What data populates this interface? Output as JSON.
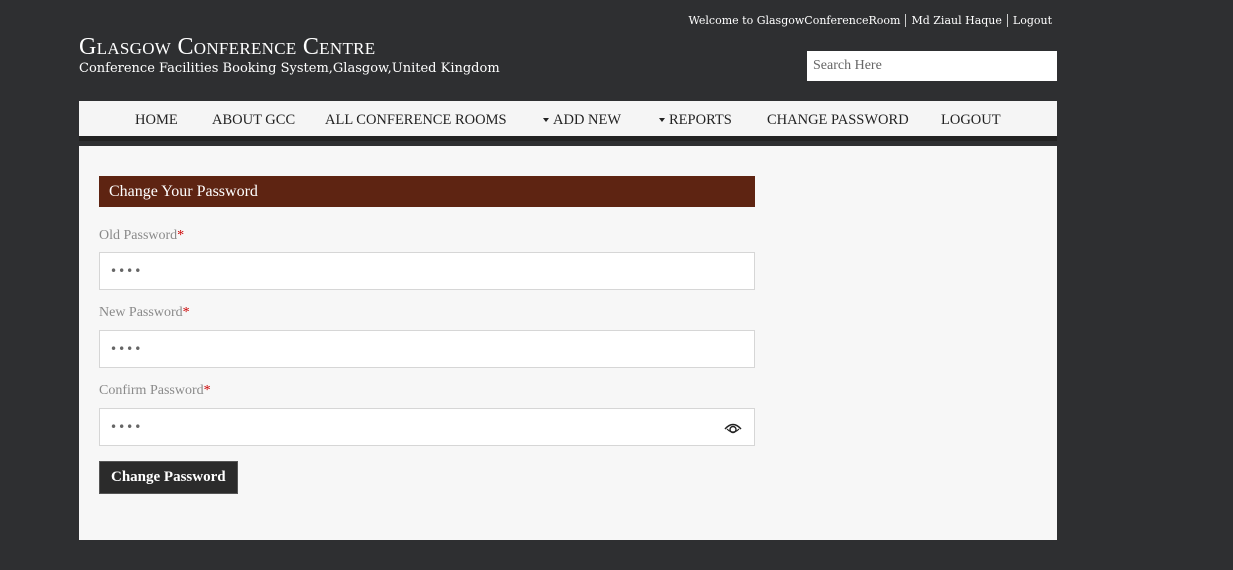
{
  "topbar": {
    "welcome": "Welcome to GlasgowConferenceRoom",
    "user": "Md Ziaul Haque",
    "logout": "Logout"
  },
  "brand": {
    "title": "Glasgow Conference Centre",
    "subtitle": "Conference Facilities Booking System,Glasgow,United Kingdom"
  },
  "search": {
    "placeholder": "Search Here",
    "value": ""
  },
  "nav": {
    "items": [
      {
        "label": "HOME",
        "dropdown": false
      },
      {
        "label": "ABOUT GCC",
        "dropdown": false
      },
      {
        "label": "ALL CONFERENCE ROOMS",
        "dropdown": false
      },
      {
        "label": "ADD NEW",
        "dropdown": true
      },
      {
        "label": "REPORTS",
        "dropdown": true
      },
      {
        "label": "CHANGE PASSWORD",
        "dropdown": false
      },
      {
        "label": "LOGOUT",
        "dropdown": false
      }
    ]
  },
  "form": {
    "heading": "Change Your Password",
    "old_label": "Old Password",
    "new_label": "New Password",
    "confirm_label": "Confirm Password",
    "required_mark": "*",
    "old_value": "••••",
    "new_value": "••••",
    "confirm_value": "••••",
    "submit_label": "Change Password"
  },
  "icons": {
    "reveal": "eye-icon"
  },
  "colors": {
    "background": "#2e2f31",
    "heading_bar": "#5e2412",
    "button": "#2b2b2b",
    "required": "#cc0000"
  }
}
